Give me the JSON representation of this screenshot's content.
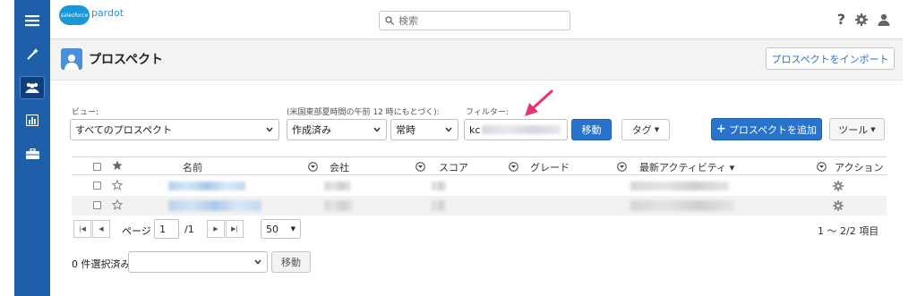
{
  "app": {
    "logo_cloud": "salesforce",
    "logo_name": "pardot"
  },
  "search": {
    "placeholder": "検索"
  },
  "page": {
    "title": "プロスペクト",
    "import_button": "プロスペクトをインポート"
  },
  "filters": {
    "view_label": "ビュー:",
    "view_value": "すべてのプロスペクト",
    "time_label": "(米国東部夏時間の午前 12 時にもとづく):",
    "date_value": "作成済み",
    "period_value": "常時",
    "filter_label": "フィルター:",
    "filter_value": "kc",
    "move_button": "移動",
    "tag_button": "タグ",
    "add_button": "プロスペクトを追加",
    "tools_button": "ツール"
  },
  "table": {
    "headers": {
      "name": "名前",
      "company": "会社",
      "score": "スコア",
      "grade": "グレード",
      "activity": "最新アクティビティ ▾",
      "action": "アクション"
    },
    "rows": [
      {
        "starred": false
      },
      {
        "starred": false
      }
    ]
  },
  "pager": {
    "page_label": "ページ",
    "page_value": "1",
    "page_total": "/1",
    "per_page": "50",
    "range": "1 〜 2/2 項目"
  },
  "bulk": {
    "selected_label": "0 件選択済み:",
    "go_button": "移動"
  },
  "colors": {
    "sidebar": "#1f5ea8",
    "primary": "#2a73cc",
    "annotation_arrow": "#e8336d"
  }
}
